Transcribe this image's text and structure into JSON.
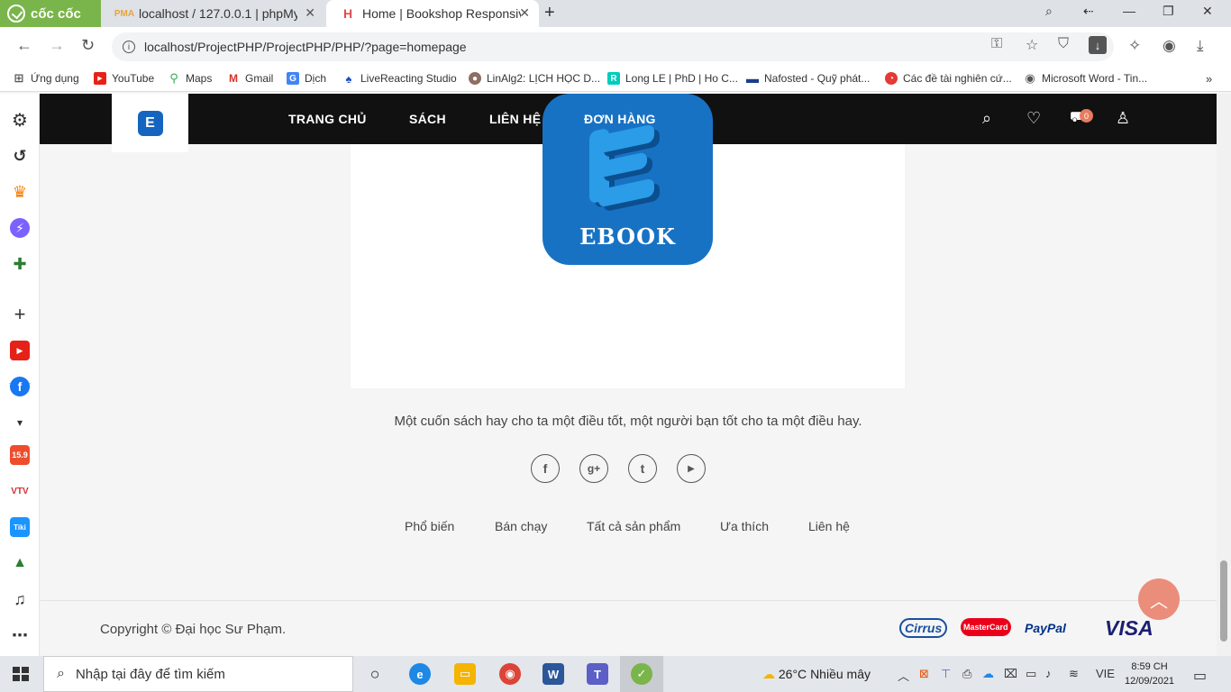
{
  "browser": {
    "brand": "cốc cốc",
    "tabs": [
      {
        "favicon": "PMA",
        "title": "localhost / 127.0.0.1 | phpMy"
      },
      {
        "favicon": "H",
        "title": "Home | Bookshop Responsive"
      }
    ],
    "url": "localhost/ProjectPHP/ProjectPHP/PHP/?page=homepage"
  },
  "bookmarks": [
    {
      "label": "Ứng dụng",
      "icon": "apps-grid-icon"
    },
    {
      "label": "YouTube",
      "icon": "youtube-icon"
    },
    {
      "label": "Maps",
      "icon": "maps-pin-icon"
    },
    {
      "label": "Gmail",
      "icon": "gmail-icon"
    },
    {
      "label": "Dịch",
      "icon": "translate-icon"
    },
    {
      "label": "LiveReacting Studio",
      "icon": "livereacting-icon"
    },
    {
      "label": "LinAlg2: LỊCH HỌC D...",
      "icon": "avatar-icon"
    },
    {
      "label": "Long LE | PhD | Ho C...",
      "icon": "researchgate-icon"
    },
    {
      "label": "Nafosted - Quỹ phát...",
      "icon": "nafosted-icon"
    },
    {
      "label": "Các đề tài nghiên cứ...",
      "icon": "globe-icon"
    },
    {
      "label": "Microsoft Word - Tin...",
      "icon": "word-doc-icon"
    }
  ],
  "site": {
    "nav": [
      "TRANG CHỦ",
      "SÁCH",
      "LIÊN HỆ",
      "ĐƠN HÀNG"
    ],
    "cart_count": "0",
    "banner_label": "EBOOK",
    "tagline": "Một cuốn sách hay cho ta một điều tốt, một người bạn tốt cho ta một điều hay.",
    "social": [
      {
        "glyph": "f",
        "icon": "facebook-icon"
      },
      {
        "glyph": "g+",
        "icon": "google-plus-icon"
      },
      {
        "glyph": "t",
        "icon": "tumblr-icon"
      },
      {
        "glyph": "▶",
        "icon": "youtube-icon"
      }
    ],
    "footer_links": [
      "Phổ biến",
      "Bán chạy",
      "Tất cả sản phẩm",
      "Ưa thích",
      "Liên hệ"
    ],
    "copyright": "Copyright © Đại học Sư Phạm.",
    "payments": [
      "Cirrus",
      "MasterCard",
      "PayPal",
      "VISA"
    ]
  },
  "taskbar": {
    "search_placeholder": "Nhập tại đây để tìm kiếm",
    "weather_temp": "26°C",
    "weather_text": "Nhiều mây",
    "lang": "VIE",
    "time": "8:59 CH",
    "date": "12/09/2021"
  },
  "colors": {
    "header_bg": "#111111",
    "accent": "#eb8d7b",
    "ebook_blue": "#1872c4",
    "brand_green": "#79b54a"
  }
}
